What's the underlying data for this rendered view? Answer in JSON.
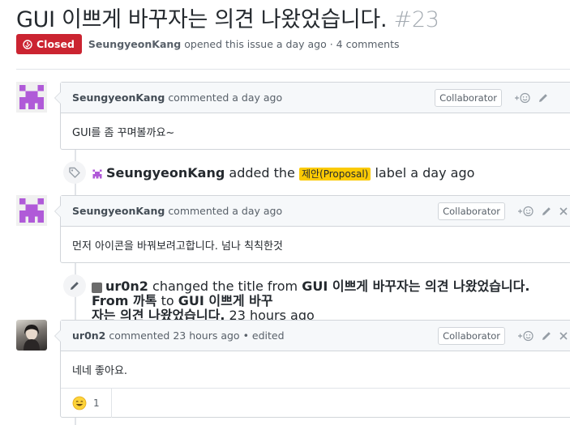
{
  "issue": {
    "title": "GUI 이쁘게 바꾸자는 의견 나왔었습니다.",
    "number": "#23",
    "state": "Closed",
    "author": "SeungyeonKang",
    "opened_text": "opened this issue a day ago · 4 comments"
  },
  "comments": [
    {
      "author": "SeungyeonKang",
      "time": "commented a day ago",
      "badge": "Collaborator",
      "body": "GUI를 좀 꾸며볼까요~"
    },
    {
      "author": "SeungyeonKang",
      "time": "commented a day ago",
      "badge": "Collaborator",
      "body": "먼저 아이콘을 바꿔보려고합니다. 넘나 칙칙한것"
    },
    {
      "author": "ur0n2",
      "time": "commented 23 hours ago",
      "edited": "• edited",
      "badge": "Collaborator",
      "body": "네네 좋아요.",
      "reaction_count": "1"
    }
  ],
  "events": {
    "label": {
      "actor": "SeungyeonKang",
      "action": "added the",
      "label": "제안(Proposal)",
      "suffix": "label a day ago",
      "label_color": "#fbca04"
    },
    "rename": {
      "actor": "ur0n2",
      "action": "changed the title from",
      "old_title": "GUI 이쁘게 바꾸자는 의견 나왔었습니다. From 까톡",
      "to": "to",
      "new_title_1": "GUI 이쁘게 바꾸",
      "new_title_2": "자는 의견 나왔었습니다.",
      "time": "23 hours ago"
    }
  },
  "colors": {
    "closed": "#cb2431",
    "identicon": "#b05ad8"
  }
}
